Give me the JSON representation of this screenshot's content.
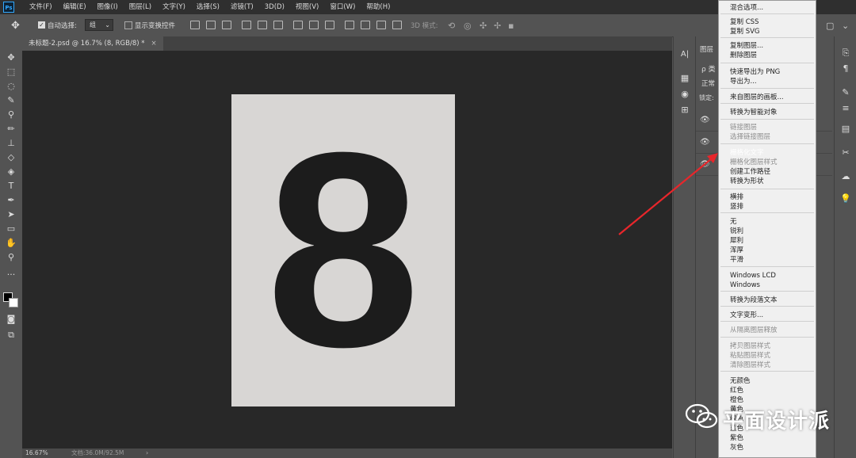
{
  "menubar": {
    "logo": "Ps",
    "items": [
      "文件(F)",
      "编辑(E)",
      "图像(I)",
      "图层(L)",
      "文字(Y)",
      "选择(S)",
      "滤镜(T)",
      "3D(D)",
      "视图(V)",
      "窗口(W)",
      "帮助(H)"
    ]
  },
  "options": {
    "auto_select_label": "自动选择:",
    "layer_select_value": "组",
    "show_transform_label": "显示变换控件",
    "mode_3d_label": "3D 模式:"
  },
  "document": {
    "tab_title": "未标题-2.psd @ 16.7% (8, RGB/8) *",
    "tab_close": "×",
    "canvas_glyph": "8"
  },
  "status": {
    "zoom": "16.67%",
    "doc_size": "文档:36.0M/92.5M",
    "arrow": "›"
  },
  "panel": {
    "layers_tab": "图层",
    "search_prefix": "ρ 类",
    "blend_mode": "正常",
    "lock_label": "锁定:",
    "char_panel_icon": "A|"
  },
  "context_menu": {
    "items": [
      {
        "label": "混合选项...",
        "disabled": false
      },
      {
        "label": "复制 CSS",
        "disabled": false
      },
      {
        "label": "复制 SVG",
        "disabled": false
      },
      {
        "label": "复制图层...",
        "disabled": false
      },
      {
        "label": "删除图层",
        "disabled": false
      },
      {
        "label": "快速导出为 PNG",
        "disabled": false
      },
      {
        "label": "导出为...",
        "disabled": false
      },
      {
        "label": "来自图层的画板...",
        "disabled": false
      },
      {
        "label": "转换为智能对象",
        "disabled": false
      },
      {
        "label": "链接图层",
        "disabled": true
      },
      {
        "label": "选择链接图层",
        "disabled": true
      },
      {
        "label": "栅格化文字",
        "disabled": false,
        "highlighted": true
      },
      {
        "label": "栅格化图层样式",
        "disabled": true
      },
      {
        "label": "创建工作路径",
        "disabled": false
      },
      {
        "label": "转换为形状",
        "disabled": false
      },
      {
        "label": "横排",
        "disabled": false
      },
      {
        "label": "竖排",
        "disabled": false
      },
      {
        "label": "无",
        "disabled": false
      },
      {
        "label": "锐利",
        "disabled": false
      },
      {
        "label": "犀利",
        "disabled": false
      },
      {
        "label": "浑厚",
        "disabled": false
      },
      {
        "label": "平滑",
        "disabled": false
      },
      {
        "label": "Windows LCD",
        "disabled": false
      },
      {
        "label": "Windows",
        "disabled": false
      },
      {
        "label": "转换为段落文本",
        "disabled": false
      },
      {
        "label": "文字变形...",
        "disabled": false
      },
      {
        "label": "从隔离图层释放",
        "disabled": true
      },
      {
        "label": "拷贝图层样式",
        "disabled": true
      },
      {
        "label": "粘贴图层样式",
        "disabled": true
      },
      {
        "label": "清除图层样式",
        "disabled": true
      },
      {
        "label": "无颜色",
        "disabled": false
      },
      {
        "label": "红色",
        "disabled": false
      },
      {
        "label": "橙色",
        "disabled": false
      },
      {
        "label": "黄色",
        "disabled": false
      },
      {
        "label": "绿色",
        "disabled": false
      },
      {
        "label": "蓝色",
        "disabled": false
      },
      {
        "label": "紫色",
        "disabled": false
      },
      {
        "label": "灰色",
        "disabled": false
      }
    ]
  },
  "watermark": {
    "text": "平面设计派"
  },
  "colors": {
    "highlight": "#0078d7",
    "arrow": "#e8262b",
    "canvas": "#282828"
  }
}
